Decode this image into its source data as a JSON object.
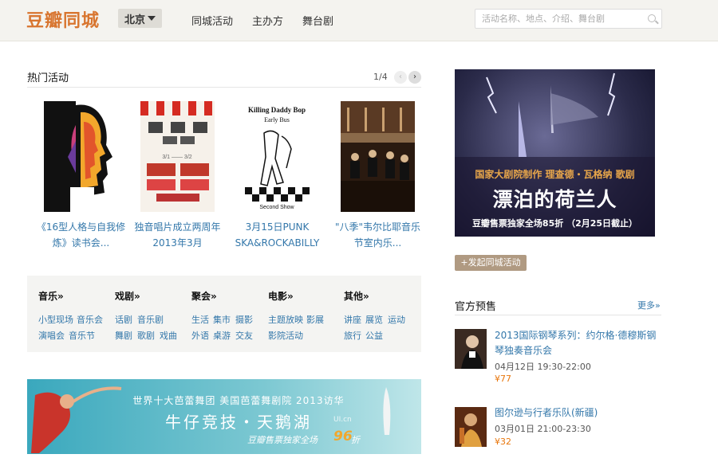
{
  "header": {
    "logo": "豆瓣同城",
    "city": "北京",
    "nav": [
      "同城活动",
      "主办方",
      "舞台剧"
    ],
    "search_placeholder": "活动名称、地点、介绍、舞台剧"
  },
  "hot": {
    "title": "热门活动",
    "pager": "1/4",
    "items": [
      {
        "caption": "《16型人格与自我修炼》读书会..."
      },
      {
        "caption": "独音唱片成立两周年2013年3月"
      },
      {
        "caption": "3月15日PUNK SKA&ROCKABILLY"
      },
      {
        "caption": "\"八季\"韦尔比耶音乐节室内乐..."
      }
    ],
    "poster2": {
      "date": "3/1 —— 3/2"
    },
    "poster3": {
      "title": "Killing Daddy Bop",
      "sub": "Early Bus",
      "footer": "Second Show"
    }
  },
  "categories": [
    {
      "head": "音乐»",
      "links": [
        [
          "小型现场",
          "音乐会"
        ],
        [
          "演唱会",
          "音乐节"
        ]
      ]
    },
    {
      "head": "戏剧»",
      "links": [
        [
          "话剧",
          "音乐剧"
        ],
        [
          "舞剧",
          "歌剧",
          "戏曲"
        ]
      ]
    },
    {
      "head": "聚会»",
      "links": [
        [
          "生活",
          "集市",
          "摄影"
        ],
        [
          "外语",
          "桌游",
          "交友"
        ]
      ]
    },
    {
      "head": "电影»",
      "links": [
        [
          "主题放映",
          "影展"
        ],
        [
          "影院活动"
        ]
      ]
    },
    {
      "head": "其他»",
      "links": [
        [
          "讲座",
          "展览",
          "运动"
        ],
        [
          "旅行",
          "公益"
        ]
      ]
    }
  ],
  "banner": {
    "line1": "世界十大芭蕾舞团 美国芭蕾舞剧院 2013访华",
    "line2": "牛仔竞技・天鹅湖",
    "line3": "豆瓣售票独家全场",
    "discount": "96",
    "discount_suffix": "折",
    "watermark": "UI.cn"
  },
  "ad": {
    "line1": "国家大剧院制作 理查德・瓦格纳 歌剧",
    "line2": "漂泊的荷兰人",
    "line3": "豆瓣售票独家全场85折 （2月25日截止）"
  },
  "start_button": "+发起同城活动",
  "official": {
    "title": "官方预售",
    "more": "更多»",
    "items": [
      {
        "title": "2013国际钢琴系列：约尔格·德穆斯钢琴独奏音乐会",
        "time": "04月12日 19:30-22:00",
        "price": "¥77"
      },
      {
        "title": "图尔逊与行者乐队(新疆)",
        "time": "03月01日 21:00-23:30",
        "price": "¥32"
      }
    ]
  }
}
